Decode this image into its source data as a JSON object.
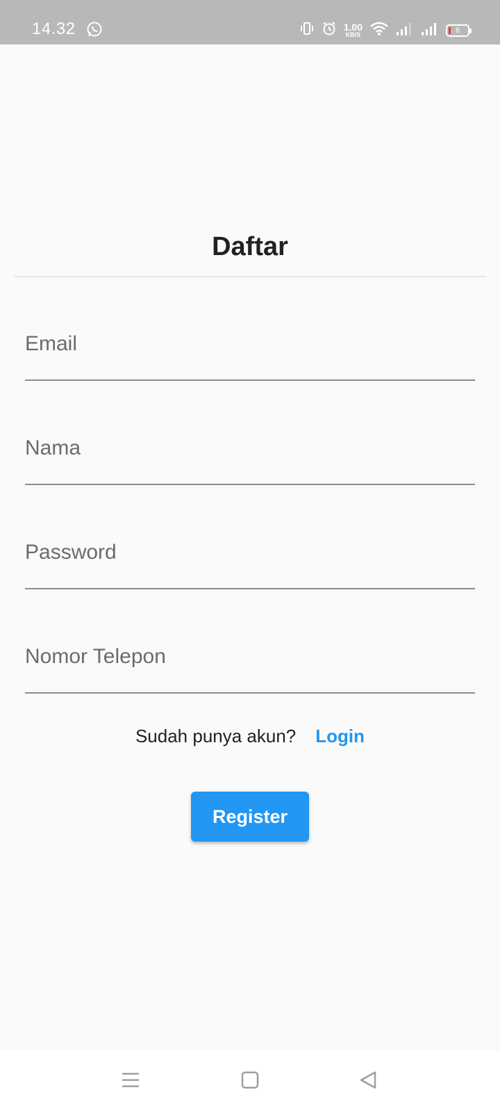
{
  "status_bar": {
    "time": "14.32",
    "network_speed_value": "1.00",
    "network_speed_unit": "KB/S",
    "battery_level": "6",
    "icons": [
      "whatsapp-icon",
      "vibrate-icon",
      "alarm-icon",
      "wifi-icon",
      "signal-icon",
      "signal-icon",
      "battery-icon"
    ]
  },
  "page": {
    "title": "Daftar"
  },
  "form": {
    "email_placeholder": "Email",
    "name_placeholder": "Nama",
    "password_placeholder": "Password",
    "phone_placeholder": "Nomor Telepon"
  },
  "login_prompt": {
    "text": "Sudah punya akun?",
    "link_label": "Login"
  },
  "actions": {
    "register_label": "Register"
  },
  "nav_bar": {
    "icons": [
      "menu-icon",
      "home-icon",
      "back-icon"
    ]
  },
  "colors": {
    "accent": "#2196f3",
    "status_bar_bg": "#b8b8b8",
    "background": "#fafafa"
  }
}
